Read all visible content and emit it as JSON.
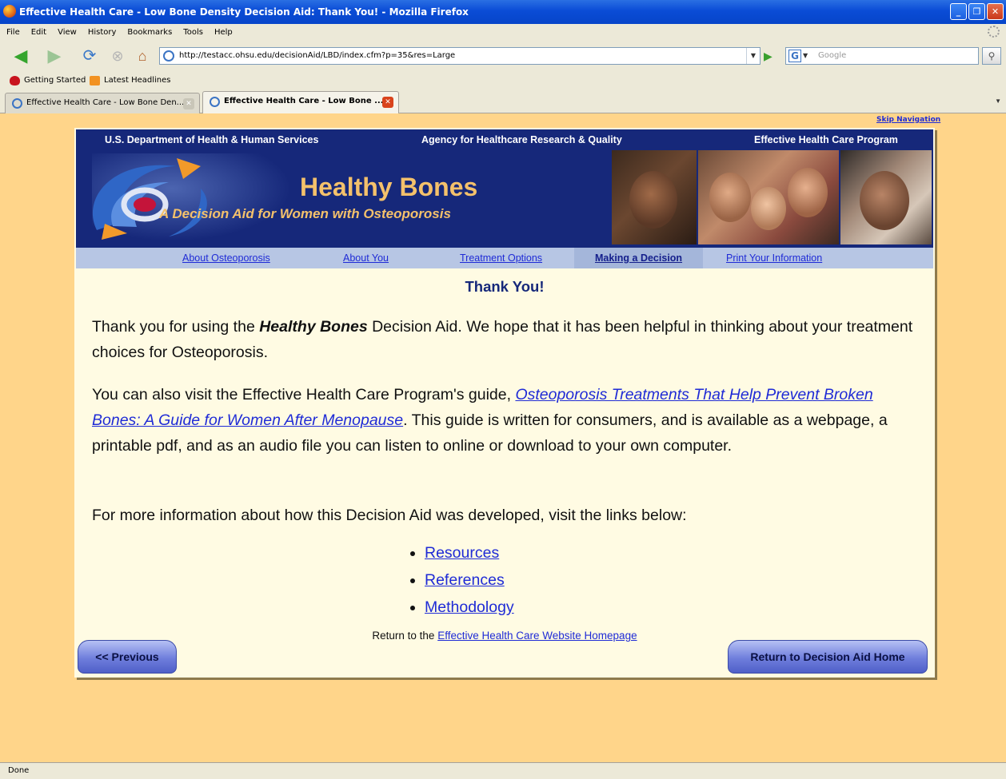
{
  "window": {
    "title": "Effective Health Care - Low Bone Density Decision Aid: Thank You! - Mozilla Firefox"
  },
  "menu": [
    "File",
    "Edit",
    "View",
    "History",
    "Bookmarks",
    "Tools",
    "Help"
  ],
  "address": {
    "url": "http://testacc.ohsu.edu/decisionAid/LBD/index.cfm?p=35&res=Large",
    "search_placeholder": "Google"
  },
  "bookmarks": [
    "Getting Started",
    "Latest Headlines"
  ],
  "tabs": [
    {
      "label": "Effective Health Care - Low Bone Den..."
    },
    {
      "label": "Effective Health Care - Low Bone ..."
    }
  ],
  "status": "Done",
  "page": {
    "skip_nav": "Skip Navigation",
    "banner": {
      "hhs": "U.S. Department of Health & Human Services",
      "ahrq": "Agency for Healthcare Research & Quality",
      "ehc": "Effective Health Care Program",
      "title": "Healthy Bones",
      "subtitle": "A Decision Aid for Women with Osteoporosis"
    },
    "nav": [
      {
        "label": "About Osteoporosis"
      },
      {
        "label": "About You"
      },
      {
        "label": "Treatment Options"
      },
      {
        "label": "Making a Decision"
      },
      {
        "label": "Print Your Information"
      }
    ],
    "heading": "Thank You!",
    "p1": {
      "before": "Thank you for using the ",
      "bold": "Healthy Bones",
      "after": " Decision Aid. We hope that it has been helpful in thinking about your treatment choices for Osteoporosis."
    },
    "p2": {
      "before": "You can also visit the Effective Health Care Program's guide, ",
      "link": "Osteoporosis Treatments That Help Prevent Broken Bones: A Guide for Women After Menopause",
      "after": ". This guide is written for consumers, and is available as a webpage, a printable pdf, and as an audio file you can listen to online or download to your own computer."
    },
    "p3": "For more information about how this Decision Aid was developed, visit the links below:",
    "links": [
      "Resources",
      "References",
      "Methodology"
    ],
    "return": {
      "before": "Return to the ",
      "link": "Effective Health Care Website Homepage"
    },
    "prev_button": "<< Previous",
    "home_button": "Return to Decision Aid Home"
  }
}
